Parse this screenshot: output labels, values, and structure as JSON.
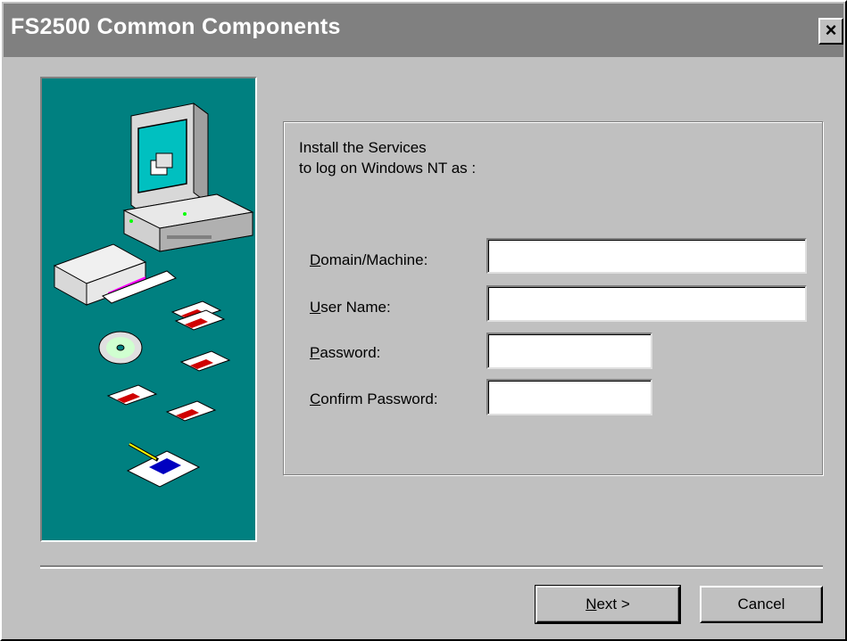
{
  "window": {
    "title": "FS2500 Common Components",
    "close_label": "×"
  },
  "intro": {
    "line1": "Install the Services",
    "line2": "to log on Windows NT  as :"
  },
  "form": {
    "domain": {
      "mnemonic": "D",
      "label_rest": "omain/Machine:",
      "value": ""
    },
    "username": {
      "mnemonic": "U",
      "label_rest": "ser Name:",
      "value": ""
    },
    "password": {
      "mnemonic": "P",
      "label_rest": "assword:",
      "value": ""
    },
    "confirm": {
      "mnemonic": "C",
      "label_rest": "onfirm Password:",
      "value": ""
    }
  },
  "buttons": {
    "next_mnemonic": "N",
    "next_rest": "ext >",
    "cancel_label": "Cancel"
  },
  "colors": {
    "title_bar": "#808080",
    "art_background": "#008080",
    "dialog_face": "#c0c0c0"
  }
}
